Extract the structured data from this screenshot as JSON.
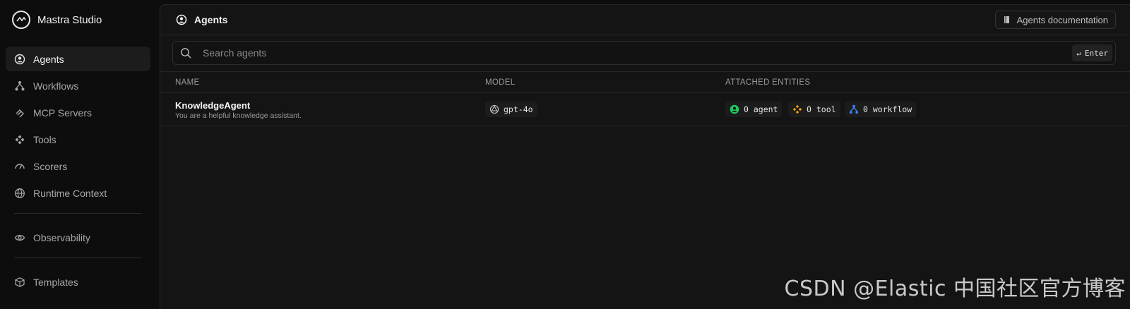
{
  "app": {
    "name": "Mastra Studio"
  },
  "sidebar": {
    "items": [
      {
        "label": "Agents",
        "icon": "user-circle-icon",
        "active": true
      },
      {
        "label": "Workflows",
        "icon": "workflow-icon"
      },
      {
        "label": "MCP Servers",
        "icon": "mcp-icon"
      },
      {
        "label": "Tools",
        "icon": "tools-icon"
      },
      {
        "label": "Scorers",
        "icon": "gauge-icon"
      },
      {
        "label": "Runtime Context",
        "icon": "globe-icon"
      },
      {
        "label": "Observability",
        "icon": "eye-icon"
      },
      {
        "label": "Templates",
        "icon": "box-icon"
      }
    ]
  },
  "header": {
    "title": "Agents",
    "docs_label": "Agents documentation"
  },
  "search": {
    "placeholder": "Search agents",
    "value": "",
    "shortcut": "Enter"
  },
  "table": {
    "columns": [
      "NAME",
      "MODEL",
      "ATTACHED ENTITIES"
    ],
    "rows": [
      {
        "name": "KnowledgeAgent",
        "description": "You are a helpful knowledge assistant.",
        "model": "gpt-4o",
        "entities": {
          "agent": "0 agent",
          "tool": "0 tool",
          "workflow": "0 workflow"
        }
      }
    ]
  },
  "watermark": "CSDN @Elastic 中国社区官方博客",
  "colors": {
    "agent": "#22c55e",
    "tool": "#f59e0b",
    "workflow": "#3b82f6"
  }
}
